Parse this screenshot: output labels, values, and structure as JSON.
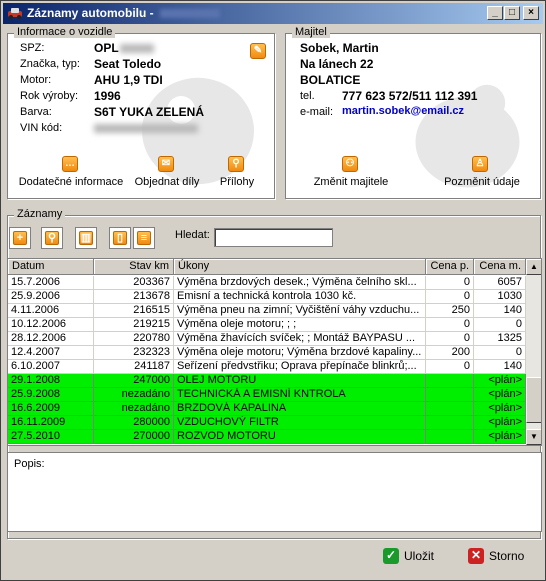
{
  "window": {
    "title": "Záznamy automobilu -"
  },
  "titlebar_buttons": {
    "minimize": "_",
    "maximize": "□",
    "close": "×"
  },
  "vehicle": {
    "group_title": "Informace o vozidle",
    "fields": [
      {
        "label": "SPZ:",
        "value": "OPL"
      },
      {
        "label": "Značka, typ:",
        "value": "Seat Toledo"
      },
      {
        "label": "Motor:",
        "value": "AHU 1,9 TDI"
      },
      {
        "label": "Rok výroby:",
        "value": "1996"
      },
      {
        "label": "Barva:",
        "value": "S6T YUKA ZELENÁ"
      },
      {
        "label": "VIN kód:",
        "value": ""
      }
    ],
    "actions": [
      {
        "label": "Dodatečné informace",
        "icon": "chat-icon"
      },
      {
        "label": "Objednat díly",
        "icon": "mail-icon"
      },
      {
        "label": "Přílohy",
        "icon": "paperclip-icon"
      }
    ]
  },
  "owner": {
    "group_title": "Majitel",
    "name": "Sobek, Martin",
    "street": "Na lánech 22",
    "city": "BOLATICE",
    "phone_label": "tel.",
    "phone": "777 623 572/511 112 391",
    "email_label": "e-mail:",
    "email": "martin.sobek@email.cz",
    "actions": [
      {
        "label": "Změnit majitele",
        "icon": "people-icon"
      },
      {
        "label": "Pozměnit údaje",
        "icon": "person-icon"
      }
    ]
  },
  "records": {
    "group_title": "Záznamy",
    "search_label": "Hledat:",
    "search_value": "",
    "columns": [
      "Datum",
      "Stav km",
      "Úkony",
      "Cena p.",
      "Cena m."
    ],
    "rows": [
      {
        "date": "15.7.2006",
        "km": "203367",
        "task": "Výměna brzdových desek.; Výměna čelního skl...",
        "price_p": "0",
        "price_m": "6057",
        "planned": false
      },
      {
        "date": "25.9.2006",
        "km": "213678",
        "task": "Emisní a technická kontrola 1030 kč.",
        "price_p": "0",
        "price_m": "1030",
        "planned": false
      },
      {
        "date": "4.11.2006",
        "km": "216515",
        "task": "Výměna pneu na zimní; Vyčištění váhy vzduchu...",
        "price_p": "250",
        "price_m": "140",
        "planned": false
      },
      {
        "date": "10.12.2006",
        "km": "219215",
        "task": "Výměna oleje motoru; ; ;",
        "price_p": "0",
        "price_m": "0",
        "planned": false
      },
      {
        "date": "28.12.2006",
        "km": "220780",
        "task": "Výměna žhavících svíček; ; Montáž BAYPASU ...",
        "price_p": "0",
        "price_m": "1325",
        "planned": false
      },
      {
        "date": "12.4.2007",
        "km": "232323",
        "task": "Výměna oleje motoru; Výměna brzdové kapaliny...",
        "price_p": "200",
        "price_m": "0",
        "planned": false
      },
      {
        "date": "6.10.2007",
        "km": "241187",
        "task": "Seřízení předvstřiku; Oprava přepínače blinkrů;...",
        "price_p": "0",
        "price_m": "140",
        "planned": false
      },
      {
        "date": "29.1.2008",
        "km": "247000",
        "task": "OLEJ MOTORU",
        "price_p": "",
        "price_m": "<plán>",
        "planned": true
      },
      {
        "date": "25.9.2008",
        "km": "nezadáno",
        "task": "TECHNICKÁ A EMISNÍ KNTROLA",
        "price_p": "",
        "price_m": "<plán>",
        "planned": true
      },
      {
        "date": "16.6.2009",
        "km": "nezadáno",
        "task": "BRZDOVÁ KAPALINA",
        "price_p": "",
        "price_m": "<plán>",
        "planned": true
      },
      {
        "date": "16.11.2009",
        "km": "280000",
        "task": "VZDUCHOVÝ FILTR",
        "price_p": "",
        "price_m": "<plán>",
        "planned": true
      },
      {
        "date": "27.5.2010",
        "km": "270000",
        "task": "ROZVOD MOTORU",
        "price_p": "",
        "price_m": "<plán>",
        "planned": true
      }
    ],
    "description_label": "Popis:"
  },
  "buttons": {
    "save": "Uložit",
    "cancel": "Storno"
  },
  "colors": {
    "planned_row": "#00ee00",
    "email_link": "#0000cc",
    "accent_orange": "#f08a10"
  }
}
